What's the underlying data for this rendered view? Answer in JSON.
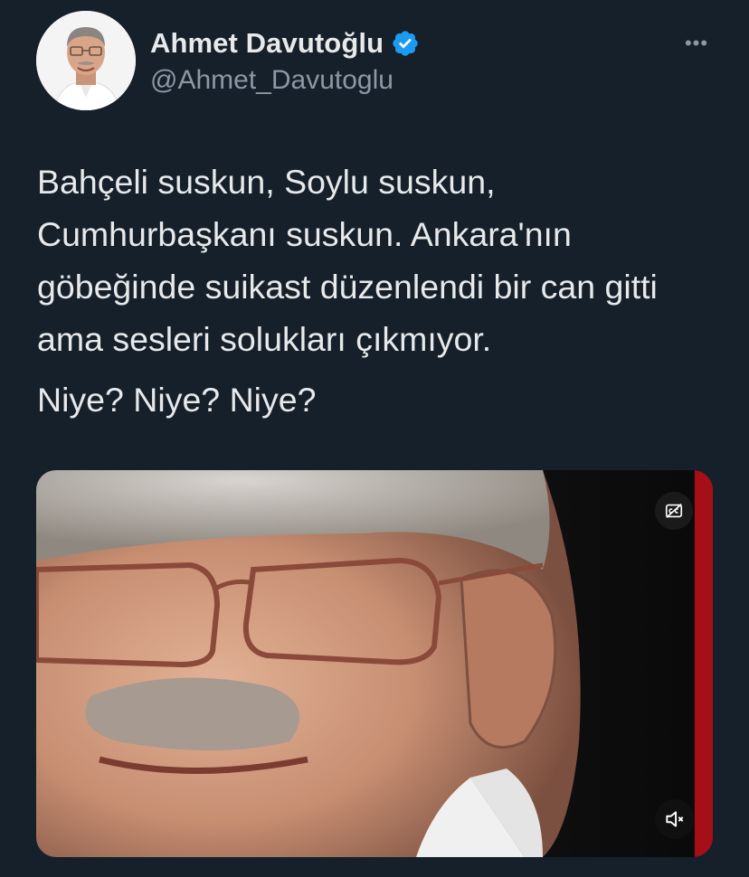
{
  "author": {
    "display_name": "Ahmet Davutoğlu",
    "handle": "@Ahmet_Davutoglu",
    "verified": true,
    "avatar_icon": "profile-photo"
  },
  "tweet": {
    "paragraph1": "Bahçeli suskun, Soylu suskun, Cumhurbaşkanı suskun. Ankara'nın göbeğinde suikast düzenlendi bir can gitti ama sesleri solukları çıkmıyor.",
    "paragraph2": "Niye? Niye? Niye?"
  },
  "media": {
    "type": "video",
    "controls": {
      "captions_icon": "captions-off-icon",
      "mute_icon": "volume-muted-icon"
    }
  },
  "menu": {
    "more_icon": "more-horizontal-icon",
    "more_label": "•••"
  },
  "colors": {
    "background": "#15202b",
    "text_primary": "#e7e9ea",
    "text_secondary": "#8b98a5",
    "verified_badge": "#1d9bf0"
  }
}
